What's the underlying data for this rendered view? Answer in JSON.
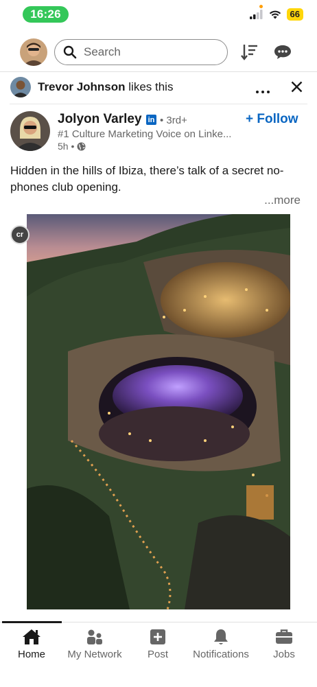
{
  "status_bar": {
    "time": "16:26",
    "battery": "66"
  },
  "header": {
    "search_placeholder": "Search",
    "icons": [
      "sort-icon",
      "messaging-icon"
    ]
  },
  "social_context": {
    "actor": "Trevor Johnson",
    "action": "likes this"
  },
  "post": {
    "author_name": "Jolyon Varley",
    "linkedin_badge": "in",
    "degree": "• 3rd+",
    "headline": "#1 Culture Marketing Voice on Linke...",
    "time": "5h •",
    "follow_label": "+ Follow",
    "text": "Hidden in the hills of Ibiza, there’s talk of a secret no-phones club opening.",
    "more_label": "...more",
    "image_badge": "cr"
  },
  "bottom_nav": {
    "items": [
      {
        "label": "Home",
        "icon": "home-icon",
        "active": true
      },
      {
        "label": "My Network",
        "icon": "network-icon",
        "active": false
      },
      {
        "label": "Post",
        "icon": "post-icon",
        "active": false
      },
      {
        "label": "Notifications",
        "icon": "bell-icon",
        "active": false
      },
      {
        "label": "Jobs",
        "icon": "briefcase-icon",
        "active": false
      }
    ]
  },
  "colors": {
    "brand_blue": "#0a66c2",
    "status_green": "#34c759",
    "battery_yellow": "#ffd60a"
  }
}
